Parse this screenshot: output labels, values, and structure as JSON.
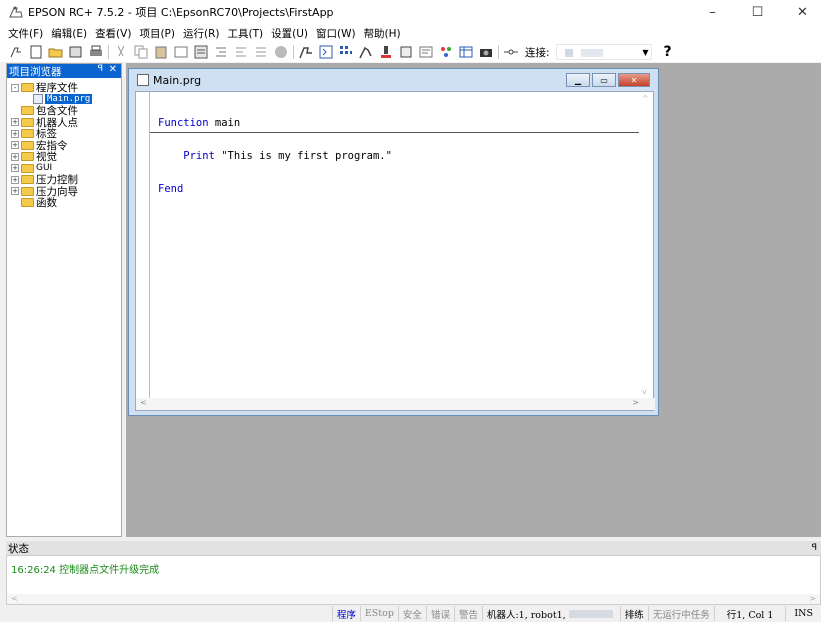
{
  "window": {
    "title": "EPSON RC+ 7.5.2 - 项目 C:\\EpsonRC70\\Projects\\FirstApp",
    "minimize": "–",
    "maximize": "☐",
    "close": "✕"
  },
  "menu": [
    "文件(F)",
    "编辑(E)",
    "查看(V)",
    "项目(P)",
    "运行(R)",
    "工具(T)",
    "设置(U)",
    "窗口(W)",
    "帮助(H)"
  ],
  "toolbar": {
    "connection_label": "连接:",
    "help": "?",
    "combo_arrow": "▼"
  },
  "explorer": {
    "title": "项目浏览器",
    "pin": "ꟼ",
    "close": "✕",
    "tree": [
      {
        "label": "程序文件",
        "expander": "⊟"
      },
      {
        "label": "Main.prg"
      },
      {
        "label": "包含文件"
      },
      {
        "label": "机器人点",
        "expander": "⊞"
      },
      {
        "label": "标签",
        "expander": "⊞"
      },
      {
        "label": "宏指令",
        "expander": "⊞"
      },
      {
        "label": "视觉",
        "expander": "⊞"
      },
      {
        "label": "GUI",
        "expander": "⊞"
      },
      {
        "label": "压力控制",
        "expander": "⊞"
      },
      {
        "label": "压力向导",
        "expander": "⊞"
      },
      {
        "label": "函数"
      }
    ]
  },
  "editor": {
    "title": "Main.prg",
    "lines": [
      {
        "kw": "Function",
        "rest": " main"
      },
      {
        "kw": "    Print",
        "rest": " \"This is my first program.\""
      },
      {
        "kw": "Fend",
        "rest": ""
      }
    ],
    "scroll_up": "^",
    "scroll_down": "v",
    "scroll_left": "<",
    "scroll_right": ">"
  },
  "status": {
    "title": "状态",
    "pin": "ꟼ",
    "message": "16:26:24 控制器点文件升级完成",
    "scroll_left": "<",
    "scroll_right": ">"
  },
  "statusbar": {
    "program": "程序",
    "estop": "EStop",
    "safety": "安全",
    "error": "错误",
    "warning": "警告",
    "robot_prefix": "机器人:1, robot1,",
    "mode": "排练",
    "tasks": "无运行中任务",
    "position": "行1, Col 1",
    "ins": "INS"
  }
}
